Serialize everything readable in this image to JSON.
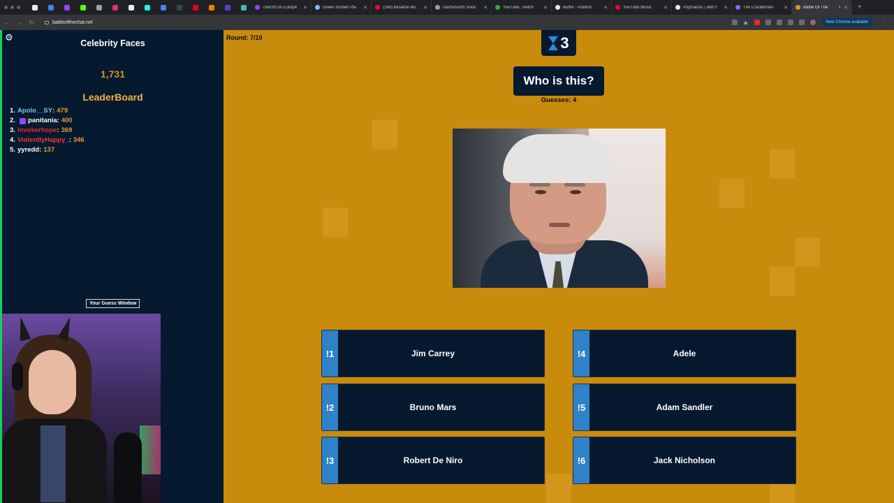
{
  "browser": {
    "tabs": [
      {
        "title": "TwitchCon Europe",
        "color": "#9146ff"
      },
      {
        "title": "Green Screen Pla",
        "color": "#8ab4f8"
      },
      {
        "title": "(168) Besame Mu",
        "color": "#ff0033"
      },
      {
        "title": "Gachimuchi Soun",
        "color": "#9aa0a6"
      },
      {
        "title": "YouTube, Twitch",
        "color": "#34a853"
      },
      {
        "title": "Buffer - Publish",
        "color": "#e8eaed"
      },
      {
        "title": "YouTube Music",
        "color": "#ff0033"
      },
      {
        "title": "PopSauce | Jklm.f",
        "color": "#e8eaed"
      },
      {
        "title": "The Cranberries",
        "color": "#7b6cf6"
      },
      {
        "title": "Battle Of The",
        "color": "#d49a2a",
        "active": true
      }
    ],
    "url": "battleofthechat.net",
    "update_label": "New Chrome available"
  },
  "sidebar": {
    "title": "Celebrity Faces",
    "total_score": "1,731",
    "leaderboard_title": "LeaderBoard",
    "leaderboard": [
      {
        "rank": "1.",
        "name": "Apolo__SY",
        "score": "479",
        "color": "#7ec8e3",
        "badge": false
      },
      {
        "rank": "2.",
        "name": "panitania",
        "score": "400",
        "color": "#ffffff",
        "badge": true
      },
      {
        "rank": "3.",
        "name": "invokerhope",
        "score": "369",
        "color": "#e0302c",
        "badge": false
      },
      {
        "rank": "4.",
        "name": "ViolentlyHappy_",
        "score": "346",
        "color": "#ef3b33",
        "badge": false
      },
      {
        "rank": "5.",
        "name": "yyredd",
        "score": "137",
        "color": "#ffffff",
        "badge": false
      }
    ],
    "guess_window_label": "Your Guess Window"
  },
  "game": {
    "round_label": "Round:  7/10",
    "timer": "3",
    "question": "Who is this?",
    "guesses_label": "Guesses:  4",
    "answers": [
      {
        "key": "!1",
        "label": "Jim Carrey"
      },
      {
        "key": "!2",
        "label": "Bruno Mars"
      },
      {
        "key": "!3",
        "label": "Robert De Niro"
      },
      {
        "key": "!4",
        "label": "Adele"
      },
      {
        "key": "!5",
        "label": "Adam Sandler"
      },
      {
        "key": "!6",
        "label": "Jack Nicholson"
      }
    ]
  }
}
